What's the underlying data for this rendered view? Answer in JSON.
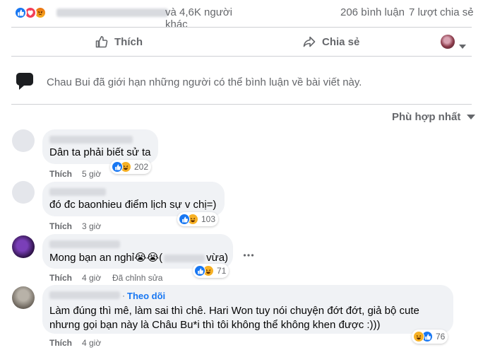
{
  "summary": {
    "others_text": "và 4,6K người khác",
    "comments_count": "206 bình luận",
    "shares_count": "7 lượt chia sẻ"
  },
  "actions": {
    "like_label": "Thích",
    "share_label": "Chia sẻ"
  },
  "notice": {
    "text": "Chau Bui đã giới hạn những người có thể bình luận về bài viết này."
  },
  "sort": {
    "label": "Phù hợp nhất"
  },
  "comments": [
    {
      "text": "Dân ta phải biết sử ta",
      "like_label": "Thích",
      "time": "5 giờ",
      "reaction_count": "202"
    },
    {
      "text": "đó đc baonhieu điểm lịch sự v chị=)",
      "like_label": "Thích",
      "time": "3 giờ",
      "reaction_count": "103"
    },
    {
      "text_before": "Mong bạn an nghỉ",
      "text_after": "vừa)",
      "emoji_text": "😭😭(",
      "like_label": "Thích",
      "time": "4 giờ",
      "edited": "Đã chỉnh sửa",
      "reaction_count": "71"
    },
    {
      "follow": "Theo dõi",
      "separator": "·",
      "text_line1": "Làm đúng thì mê, làm sai thì chê. Hari Won tuy nói chuyện đớt đớt, giả bộ cute",
      "text_line2": "nhưng gọi bạn này là Châu Bu*i thì tôi không thể không khen được :)))",
      "like_label": "Thích",
      "time": "4 giờ",
      "reaction_count": "76"
    }
  ],
  "colors": {
    "like_blue": "#1877f2",
    "love_red": "#f33e58",
    "angry_orange": "#e9710f",
    "haha_yellow": "#f7b125",
    "secondary_text": "#65676b",
    "bubble_bg": "#f0f2f5",
    "divider": "#ced0d4"
  },
  "icons": {
    "summary_reactions": [
      "like-icon",
      "love-icon",
      "angry-icon"
    ],
    "like_button": "thumbs-up-outline-icon",
    "share_button": "share-arrow-icon",
    "notice": "speech-bubble-icon",
    "sort": "caret-down-icon",
    "comment_reactions": [
      "like-icon",
      "haha-icon"
    ]
  }
}
